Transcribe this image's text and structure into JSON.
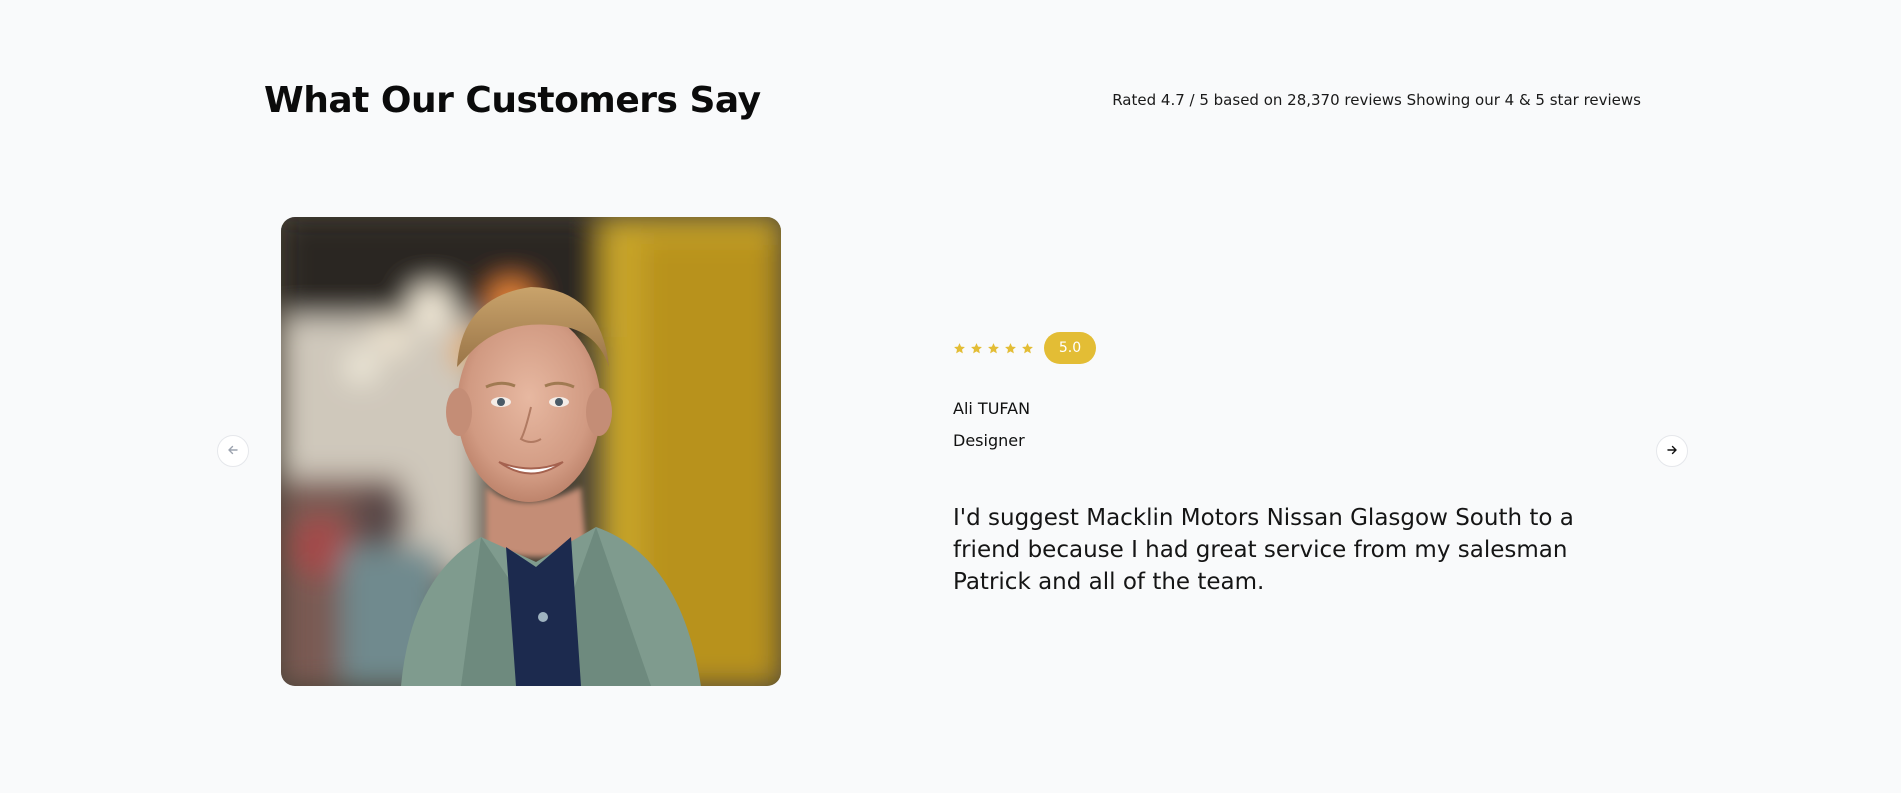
{
  "section": {
    "title": "What Our Customers Say",
    "rating_summary": "Rated 4.7 / 5 based on 28,370 reviews Showing our 4 & 5 star reviews"
  },
  "testimonial": {
    "photo": "smiling-young-man-portrait",
    "stars": 5,
    "score": "5.0",
    "name": "Ali TUFAN",
    "role": "Designer",
    "quote": "I'd suggest Macklin Motors Nissan Glasgow South to a friend because I had great service from my salesman Patrick and all of the team."
  },
  "navigation": {
    "prev_icon": "arrow-left-icon",
    "next_icon": "arrow-right-icon"
  },
  "colors": {
    "background": "#f9fafb",
    "accent": "#e3bd35",
    "text": "#111111"
  }
}
